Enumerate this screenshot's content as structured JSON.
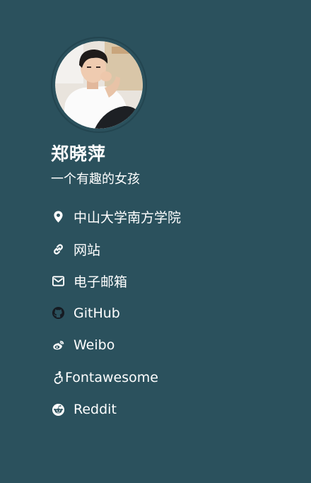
{
  "profile": {
    "name": "郑晓萍",
    "bio": "一个有趣的女孩"
  },
  "links": [
    {
      "label": "中山大学南方学院",
      "icon": "map-marker-icon"
    },
    {
      "label": "网站",
      "icon": "link-icon"
    },
    {
      "label": "电子邮箱",
      "icon": "envelope-icon"
    },
    {
      "label": "GitHub",
      "icon": "github-icon"
    },
    {
      "label": "Weibo",
      "icon": "weibo-icon"
    },
    {
      "label": "Fontawesome",
      "icon": "accessible-icon"
    },
    {
      "label": "Reddit",
      "icon": "reddit-icon"
    }
  ],
  "colors": {
    "background": "#2b515d",
    "text": "#ffffff",
    "avatar_border": "#234550"
  }
}
